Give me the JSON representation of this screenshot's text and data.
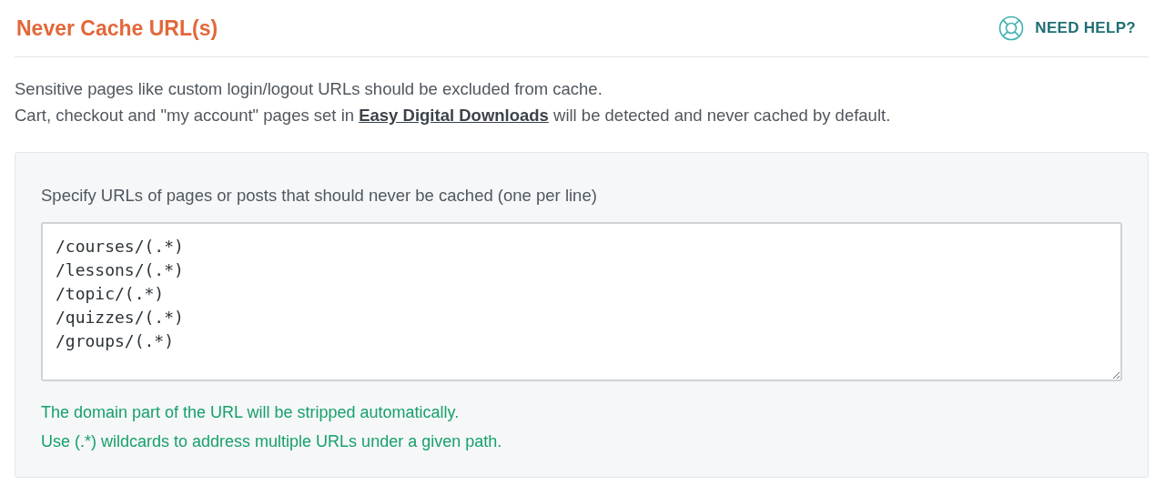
{
  "title": "Never Cache URL(s)",
  "help_link": "NEED HELP?",
  "description": [
    {
      "text": "Sensitive pages like custom login/logout URLs should be excluded from cache."
    },
    {
      "text": "Cart, checkout and \"my account\" pages set in ",
      "link": "Easy Digital Downloads",
      "after": " will be detected and never cached by default."
    }
  ],
  "field": {
    "label": "Specify URLs of pages or posts that should never be cached (one per line)",
    "lines": [
      "/courses/(.*)",
      "/lessons/(.*)",
      "/topic/(.*)",
      "/quizzes/(.*)",
      "/groups/(.*)"
    ]
  },
  "notes": [
    "The domain part of the URL will be stripped automatically.",
    "Use (.*) wildcards to address multiple URLs under a given path."
  ]
}
